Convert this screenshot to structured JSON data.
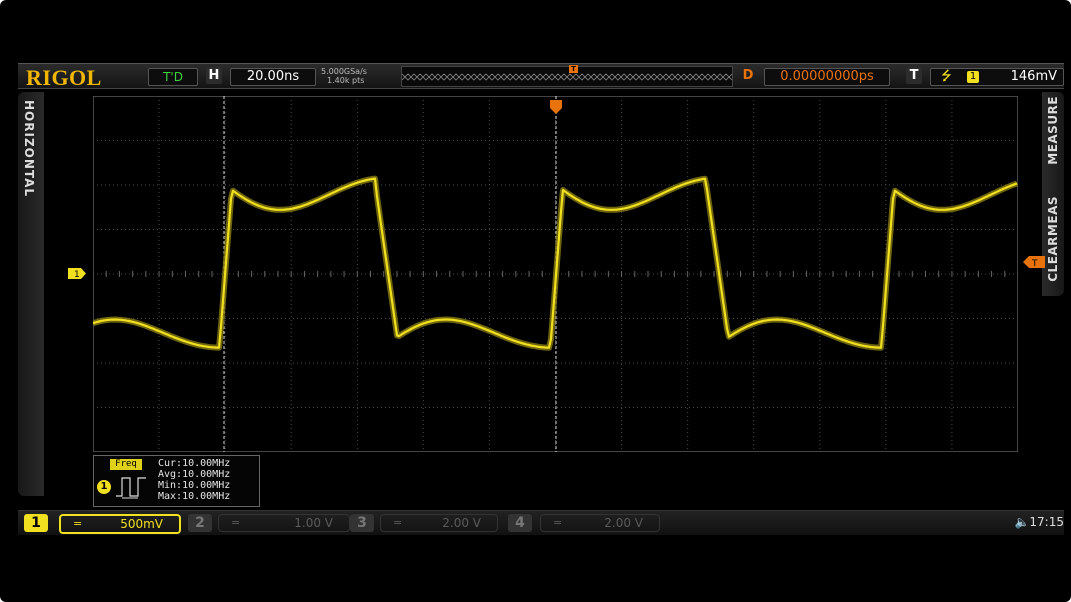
{
  "header": {
    "logo": "RIGOL",
    "run_state": "T'D",
    "horizontal_label": "H",
    "timebase": "20.00ns",
    "sample_rate": "5.000GSa/s",
    "memory_depth": "1.40k pts",
    "delay_label": "D",
    "delay_value": "0.00000000ps",
    "trigger_label": "T",
    "trigger_source": "1",
    "trigger_level": "146mV"
  },
  "side_panels": {
    "left_label": "HORIZONTAL",
    "right_label_top": "MEASURE",
    "right_label_bottom": "CLEARMEAS"
  },
  "markers": {
    "channel1_marker": "1",
    "trigger_marker": "T"
  },
  "measurement": {
    "tag": "Freq",
    "channel": "1",
    "cur": "Cur:10.00MHz",
    "avg": "Avg:10.00MHz",
    "min": "Min:10.00MHz",
    "max": "Max:10.00MHz"
  },
  "channels": [
    {
      "num": "1",
      "coupling": "=",
      "scale": "500mV",
      "active": true,
      "color": "#f0e020"
    },
    {
      "num": "2",
      "coupling": "=",
      "scale": "1.00 V",
      "active": false,
      "color": "#555555"
    },
    {
      "num": "3",
      "coupling": "=",
      "scale": "2.00 V",
      "active": false,
      "color": "#555555"
    },
    {
      "num": "4",
      "coupling": "=",
      "scale": "2.00 V",
      "active": false,
      "color": "#555555"
    }
  ],
  "status": {
    "clock": "17:15",
    "speaker_icon": "speaker-icon"
  },
  "colors": {
    "trace": "#f0e020",
    "trigger": "#e8720c",
    "logo": "#f2b705",
    "grid": "#4a4a4a"
  }
}
